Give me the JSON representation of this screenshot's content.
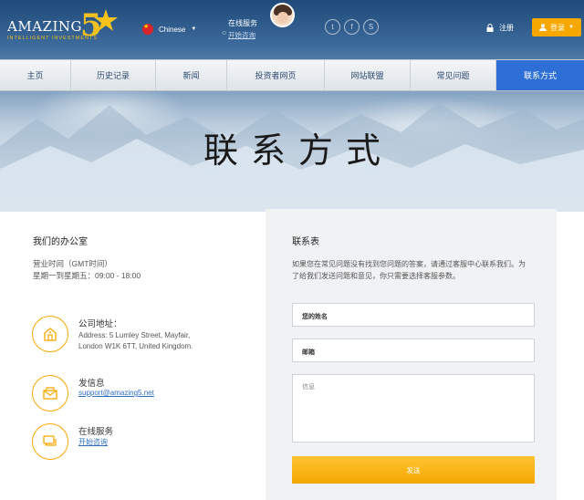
{
  "brand": {
    "logo_word": "AMAZING",
    "logo_number": "5",
    "tagline": "INTELLIGENT INVESTMENTS"
  },
  "topbar": {
    "language": "Chinese",
    "online_service_title": "在线服务",
    "online_service_link": "开始咨询",
    "register": "注册",
    "login": "登录",
    "social_icons": [
      "twitter-icon",
      "facebook-icon",
      "skype-icon"
    ]
  },
  "nav": {
    "items": [
      {
        "label": "主页"
      },
      {
        "label": "历史记录"
      },
      {
        "label": "新闻"
      },
      {
        "label": "投资者网页"
      },
      {
        "label": "网站联盟"
      },
      {
        "label": "常见问题"
      },
      {
        "label": "联系方式",
        "active": true
      }
    ]
  },
  "hero": {
    "title": "联系方式"
  },
  "office": {
    "title": "我们的办公室",
    "hours_line1": "营业时间（GMT时间）",
    "hours_line2": "星期一到星期五：09:00 - 18:00",
    "address_heading": "公司地址：",
    "address_line1": "Address: 5 Lumley Street, Mayfair,",
    "address_line2": "London W1K 6TT, United Kingdom.",
    "message_heading": "发信息",
    "message_email": "support@amazing5.net",
    "online_heading": "在线服务",
    "online_link": "开始咨询"
  },
  "form": {
    "title": "联系表",
    "description": "如果您在常见问题没有找到您问题的答案，请通过客服中心联系我们。为了给我们发送问题和意见，你只需要选择客服参数。",
    "name_placeholder": "您的姓名",
    "email_placeholder": "邮箱",
    "message_placeholder": "信息",
    "send_label": "发送"
  },
  "colors": {
    "accent": "#f6a800",
    "nav_active": "#2d6fd6",
    "link": "#2f6fc0"
  }
}
